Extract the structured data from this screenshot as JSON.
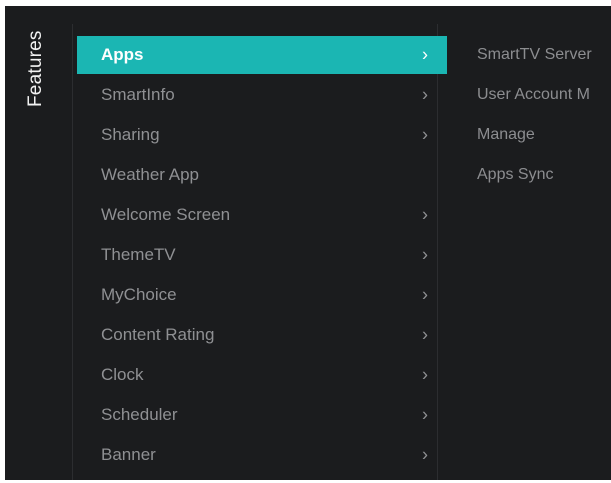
{
  "side_title": "Features",
  "menu": [
    {
      "label": "Apps",
      "chevron": "›",
      "active": true
    },
    {
      "label": "SmartInfo",
      "chevron": "›"
    },
    {
      "label": "Sharing",
      "chevron": "›"
    },
    {
      "label": "Weather App",
      "chevron": ""
    },
    {
      "label": "Welcome Screen",
      "chevron": "›"
    },
    {
      "label": "ThemeTV",
      "chevron": "›"
    },
    {
      "label": "MyChoice",
      "chevron": "›"
    },
    {
      "label": "Content Rating",
      "chevron": "›"
    },
    {
      "label": "Clock",
      "chevron": "›"
    },
    {
      "label": "Scheduler",
      "chevron": "›"
    },
    {
      "label": "Banner",
      "chevron": "›"
    }
  ],
  "submenu": [
    {
      "label": "SmartTV Server"
    },
    {
      "label": "User Account M"
    },
    {
      "label": "Manage"
    },
    {
      "label": "Apps Sync"
    }
  ],
  "colors": {
    "background": "#1b1c1e",
    "accent": "#1bb6b3",
    "text_dim": "#8f9093",
    "text_active": "#ffffff"
  }
}
